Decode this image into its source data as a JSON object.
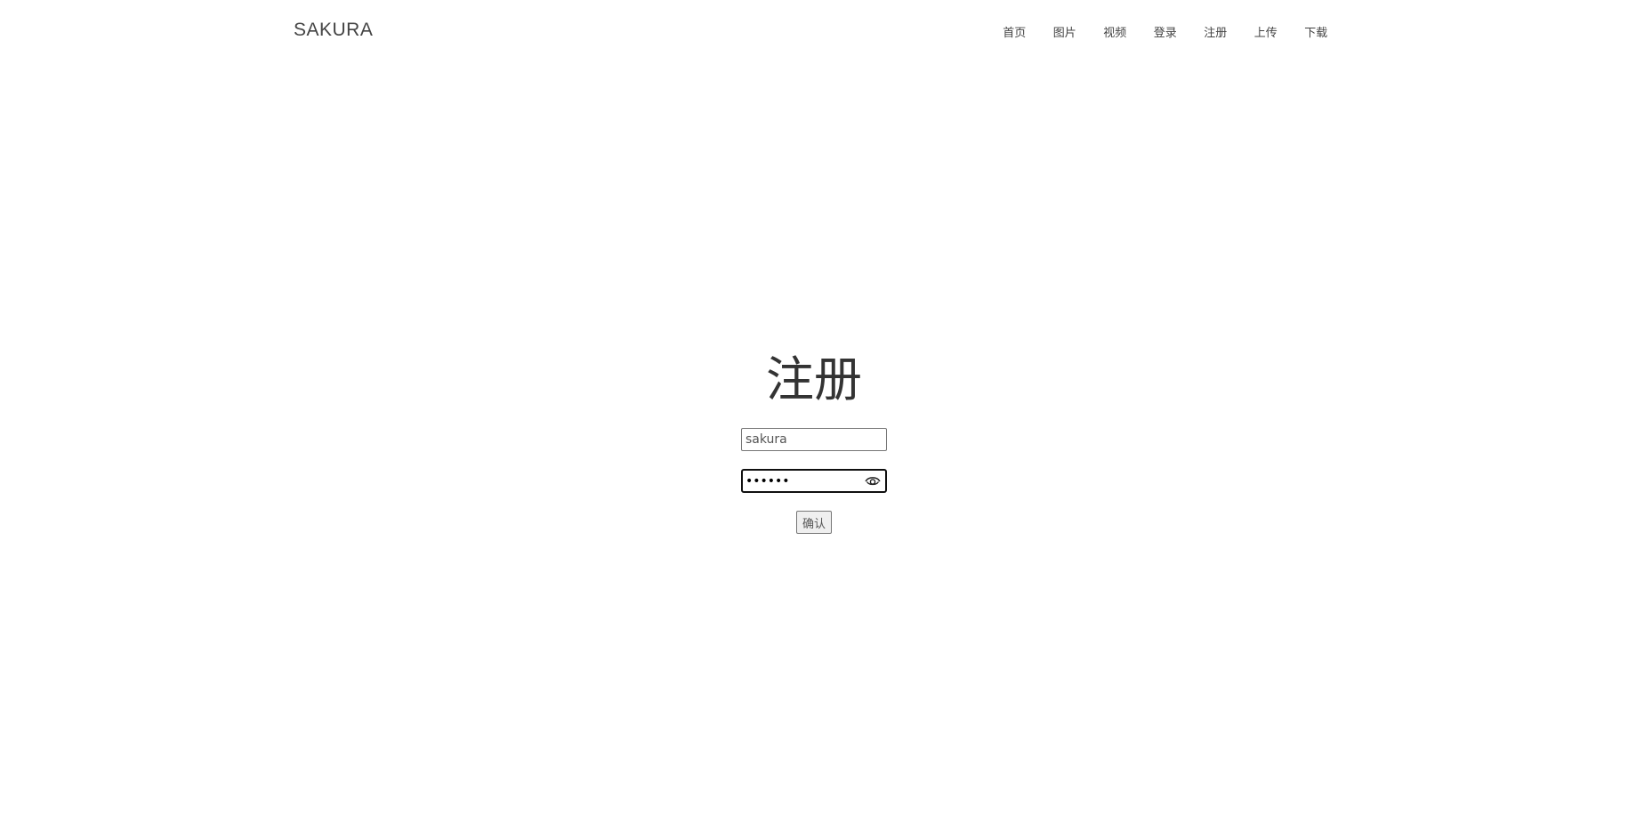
{
  "header": {
    "brand": "SAKURA",
    "nav": [
      "首页",
      "图片",
      "视频",
      "登录",
      "注册",
      "上传",
      "下载"
    ]
  },
  "main": {
    "title": "注册",
    "username_value": "sakura",
    "password_value": "••••••",
    "confirm_label": "确认"
  },
  "icons": {
    "password_toggle": "eye-icon"
  }
}
